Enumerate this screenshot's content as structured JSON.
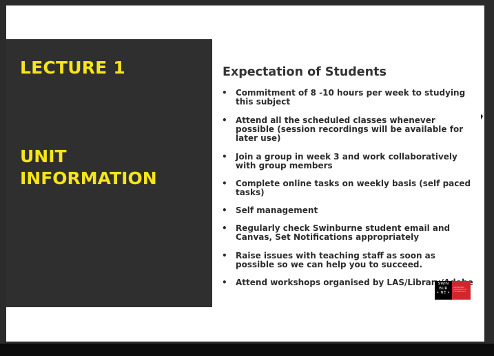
{
  "slide": {
    "lecture_title": "LECTURE 1",
    "unit_title": "UNIT\nINFORMATION",
    "heading": "Expectation of Students",
    "bullets": [
      "Commitment of 8 -10 hours per week to studying this subject",
      "Attend all the scheduled classes whenever possible (session recordings will be available for later use)",
      "Join a group in week 3 and work collaboratively with group members",
      "Complete online tasks on weekly basis (self paced tasks)",
      "Self management",
      "Regularly check Swinburne student email and Canvas, Set Notifications appropriately",
      "Raise issues with teaching staff as soon as possible so we can help you to succeed.",
      "Attend workshops organised by LAS/Library/Adobe"
    ],
    "bullet_char": "•",
    "logo": {
      "wordmark": "SWIN\nBUR\n• NE •",
      "tagline": "SWINBURNE UNIVERSITY OF TECHNOLOGY"
    }
  },
  "colors": {
    "accent_yellow": "#f7e51a",
    "panel_dark": "#2f2f2f",
    "logo_red": "#d2262e"
  }
}
